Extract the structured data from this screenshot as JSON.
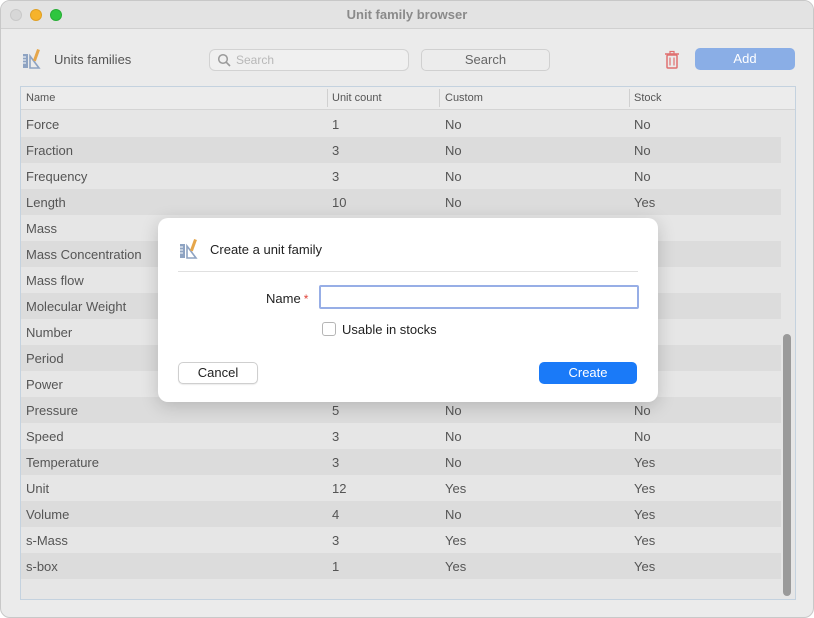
{
  "window": {
    "title": "Unit family browser"
  },
  "toolbar": {
    "icon": "ruler-pencil-icon",
    "title": "Units families",
    "search_placeholder": "Search",
    "search_label": "Search",
    "delete_icon": "trash-icon",
    "add_label": "Add",
    "accent": "#8aaee6",
    "delete_color": "#e06060"
  },
  "table": {
    "columns": [
      "Name",
      "Unit count",
      "Custom",
      "Stock"
    ],
    "rows": [
      [
        "Force",
        "1",
        "No",
        "No"
      ],
      [
        "Fraction",
        "3",
        "No",
        "No"
      ],
      [
        "Frequency",
        "3",
        "No",
        "No"
      ],
      [
        "Length",
        "10",
        "No",
        "Yes"
      ],
      [
        "Mass",
        "",
        "",
        ""
      ],
      [
        "Mass Concentration",
        "",
        "",
        ""
      ],
      [
        "Mass flow",
        "",
        "",
        ""
      ],
      [
        "Molecular Weight",
        "",
        "",
        ""
      ],
      [
        "Number",
        "",
        "",
        ""
      ],
      [
        "Period",
        "",
        "",
        ""
      ],
      [
        "Power",
        "",
        "",
        ""
      ],
      [
        "Pressure",
        "5",
        "No",
        "No"
      ],
      [
        "Speed",
        "3",
        "No",
        "No"
      ],
      [
        "Temperature",
        "3",
        "No",
        "Yes"
      ],
      [
        "Unit",
        "12",
        "Yes",
        "Yes"
      ],
      [
        "Volume",
        "4",
        "No",
        "Yes"
      ],
      [
        "s-Mass",
        "3",
        "Yes",
        "Yes"
      ],
      [
        "s-box",
        "1",
        "Yes",
        "Yes"
      ]
    ]
  },
  "dialog": {
    "icon": "ruler-pencil-icon",
    "title": "Create a unit family",
    "name_label": "Name",
    "required_mark": "*",
    "name_value": "",
    "checkbox_label": "Usable in stocks",
    "checkbox_checked": false,
    "cancel_label": "Cancel",
    "create_label": "Create",
    "primary_color": "#1a7af8"
  }
}
